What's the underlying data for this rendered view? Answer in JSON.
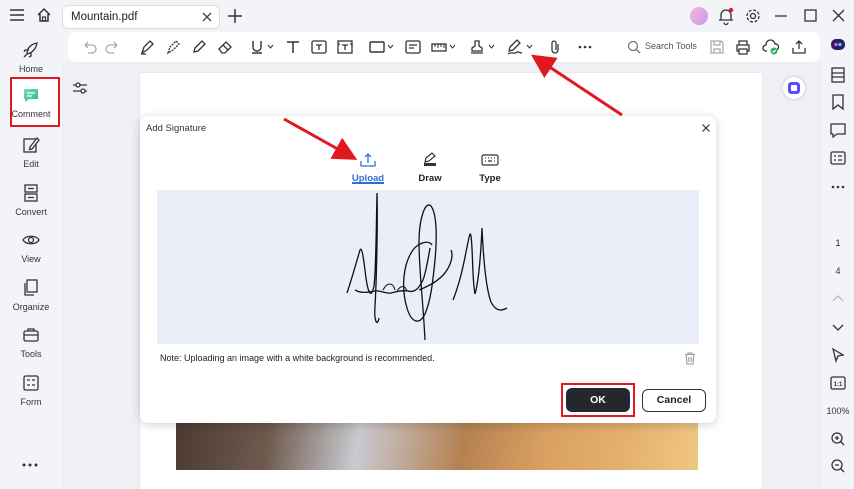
{
  "tab": {
    "title": "Mountain.pdf"
  },
  "sidebar": {
    "items": [
      {
        "label": "Home",
        "icon": "rocket-icon"
      },
      {
        "label": "Comment",
        "icon": "comment-icon"
      },
      {
        "label": "Edit",
        "icon": "edit-icon"
      },
      {
        "label": "Convert",
        "icon": "convert-icon"
      },
      {
        "label": "View",
        "icon": "eye-icon"
      },
      {
        "label": "Organize",
        "icon": "organize-icon"
      },
      {
        "label": "Tools",
        "icon": "toolbox-icon"
      },
      {
        "label": "Form",
        "icon": "form-icon"
      }
    ]
  },
  "toolbar": {
    "search_label": "Search Tools"
  },
  "right_sidebar": {
    "page_current": "1",
    "page_total": "4",
    "zoom": "100%"
  },
  "dialog": {
    "title": "Add Signature",
    "tabs": [
      {
        "label": "Upload",
        "icon": "upload-icon",
        "active": true
      },
      {
        "label": "Draw",
        "icon": "draw-icon",
        "active": false
      },
      {
        "label": "Type",
        "icon": "keyboard-icon",
        "active": false
      }
    ],
    "note": "Note: Uploading an image with a white background is recommended.",
    "ok_label": "OK",
    "cancel_label": "Cancel"
  },
  "colors": {
    "accent": "#2f6fd4",
    "annotation_red": "#e0181f",
    "ok_button": "#24272e"
  }
}
